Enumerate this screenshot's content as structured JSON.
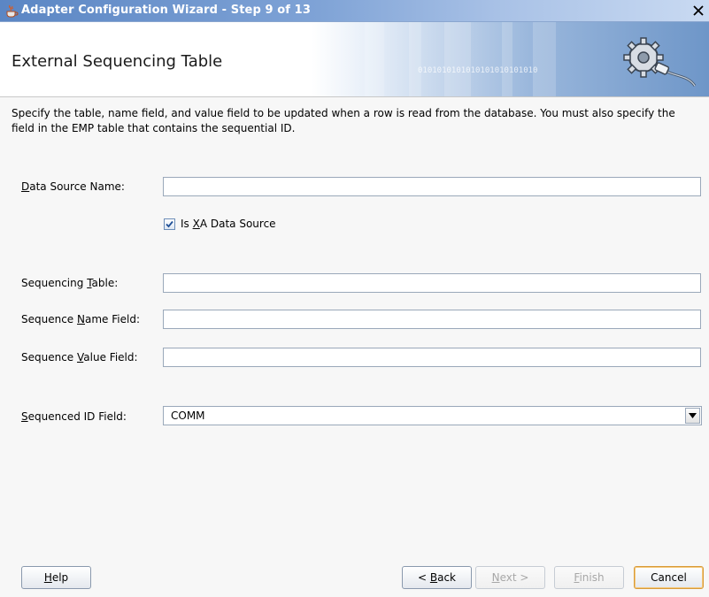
{
  "window": {
    "title": "Adapter Configuration Wizard - Step 9 of 13",
    "close_glyph": "✕"
  },
  "banner": {
    "heading": "External Sequencing Table",
    "binary_text": "0101010101010101010101010",
    "icon": "gear-plug-icon"
  },
  "description": "Specify the table, name field, and value field to be updated when a row is read from the database.  You must also specify the field in the EMP table that contains the sequential ID.",
  "form": {
    "data_source_name": {
      "label_pre": "",
      "label_key": "D",
      "label_post": "ata Source Name:",
      "value": ""
    },
    "is_xa": {
      "label_pre": "Is ",
      "label_key": "X",
      "label_post": "A Data Source",
      "checked": true
    },
    "sequencing_table": {
      "label_pre": "Sequencing ",
      "label_key": "T",
      "label_post": "able:",
      "value": ""
    },
    "sequence_name_field": {
      "label_pre": "Sequence ",
      "label_key": "N",
      "label_post": "ame Field:",
      "value": ""
    },
    "sequence_value_field": {
      "label_pre": "Sequence ",
      "label_key": "V",
      "label_post": "alue Field:",
      "value": ""
    },
    "sequenced_id_field": {
      "label_pre": "",
      "label_key": "S",
      "label_post": "equenced ID Field:",
      "value": "COMM"
    }
  },
  "buttons": {
    "help": {
      "pre": "",
      "key": "H",
      "post": "elp"
    },
    "back": {
      "pre": "< ",
      "key": "B",
      "post": "ack"
    },
    "next": {
      "pre": "",
      "key": "N",
      "post": "ext >"
    },
    "finish": {
      "pre": "",
      "key": "F",
      "post": "inish"
    },
    "cancel": {
      "pre": "Cancel",
      "key": "",
      "post": ""
    }
  },
  "colors": {
    "titlebar_start": "#5b86c4",
    "default_button_border": "#d89b3a",
    "checkmark": "#1f4f96"
  }
}
